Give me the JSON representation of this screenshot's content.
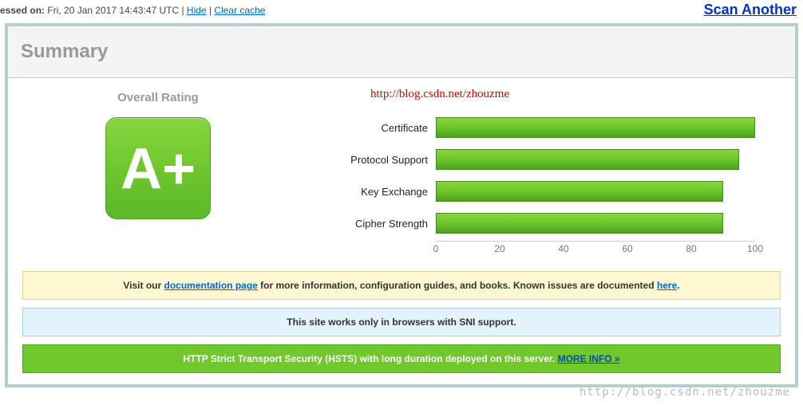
{
  "top": {
    "assessed_label": "essed on:",
    "assessed_value": "Fri, 20 Jan 2017 14:43:47 UTC",
    "sep": " | ",
    "hide": "Hide",
    "clear_cache": "Clear cache",
    "scan_another": "Scan Another"
  },
  "panel": {
    "title": "Summary"
  },
  "rating": {
    "title": "Overall Rating",
    "grade": "A+"
  },
  "watermark": "http://blog.csdn.net/zhouzme",
  "chart_data": {
    "type": "bar",
    "categories": [
      "Certificate",
      "Protocol Support",
      "Key Exchange",
      "Cipher Strength"
    ],
    "values": [
      100,
      95,
      90,
      90
    ],
    "xlabel": "",
    "ylabel": "",
    "ylim": [
      0,
      100
    ],
    "ticks": [
      0,
      20,
      40,
      60,
      80,
      100
    ]
  },
  "notices": {
    "doc": {
      "t1": "Visit our ",
      "link1": "documentation page",
      "t2": " for more information, configuration guides, and books. Known issues are documented ",
      "link2": "here",
      "t3": "."
    },
    "sni": "This site works only in browsers with SNI support.",
    "hsts": {
      "text": "HTTP Strict Transport Security (HSTS) with long duration deployed on this server.  ",
      "link": "MORE INFO »"
    }
  },
  "watermark_bottom": "http://blog.csdn.net/zhouzme"
}
